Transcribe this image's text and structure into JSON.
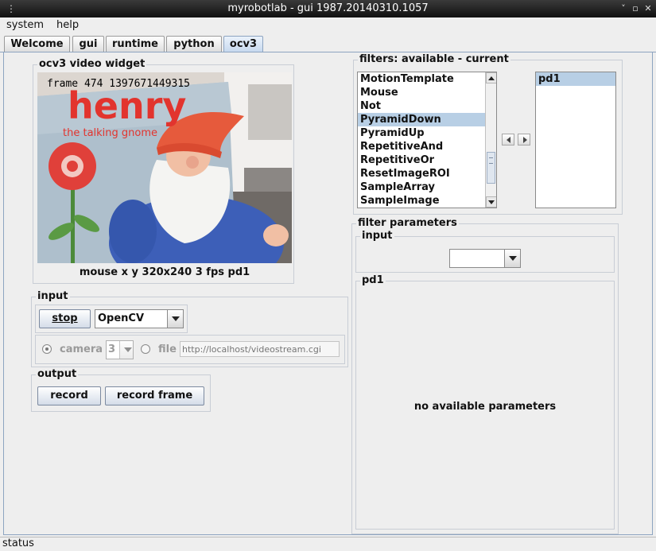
{
  "window": {
    "title": "myrobotlab - gui 1987.20140310.1057"
  },
  "menu": {
    "items": [
      "system",
      "help"
    ]
  },
  "tabs": [
    "Welcome",
    "gui",
    "runtime",
    "python",
    "ocv3"
  ],
  "video_widget": {
    "title": "ocv3 video widget",
    "overlay_text": "frame 474 1397671449315",
    "image_texts": {
      "brand": "henry",
      "tagline": "the talking gnome"
    },
    "status": "mouse x y 320x240 3 fps pd1"
  },
  "input_panel": {
    "title": "input",
    "stop_label": "stop",
    "grabber_selected": "OpenCV",
    "camera_label": "camera",
    "camera_index": "3",
    "file_label": "file",
    "file_placeholder": "http://localhost/videostream.cgi"
  },
  "output_panel": {
    "title": "output",
    "record_label": "record",
    "record_frame_label": "record frame"
  },
  "filters": {
    "title": "filters: available - current",
    "available": [
      "MotionTemplate",
      "Mouse",
      "Not",
      "PyramidDown",
      "PyramidUp",
      "RepetitiveAnd",
      "RepetitiveOr",
      "ResetImageROI",
      "SampleArray",
      "SampleImage"
    ],
    "available_selected": "PyramidDown",
    "current": [
      "pd1"
    ]
  },
  "filter_parameters": {
    "title": "filter parameters",
    "input_title": "input",
    "pd1_title": "pd1",
    "no_params": "no available parameters"
  },
  "status_bar": {
    "text": "status"
  },
  "colors": {
    "selection": "#b8cfe5",
    "tab_active": "#c6d8ee",
    "titlebar": "#1a1a1a"
  }
}
